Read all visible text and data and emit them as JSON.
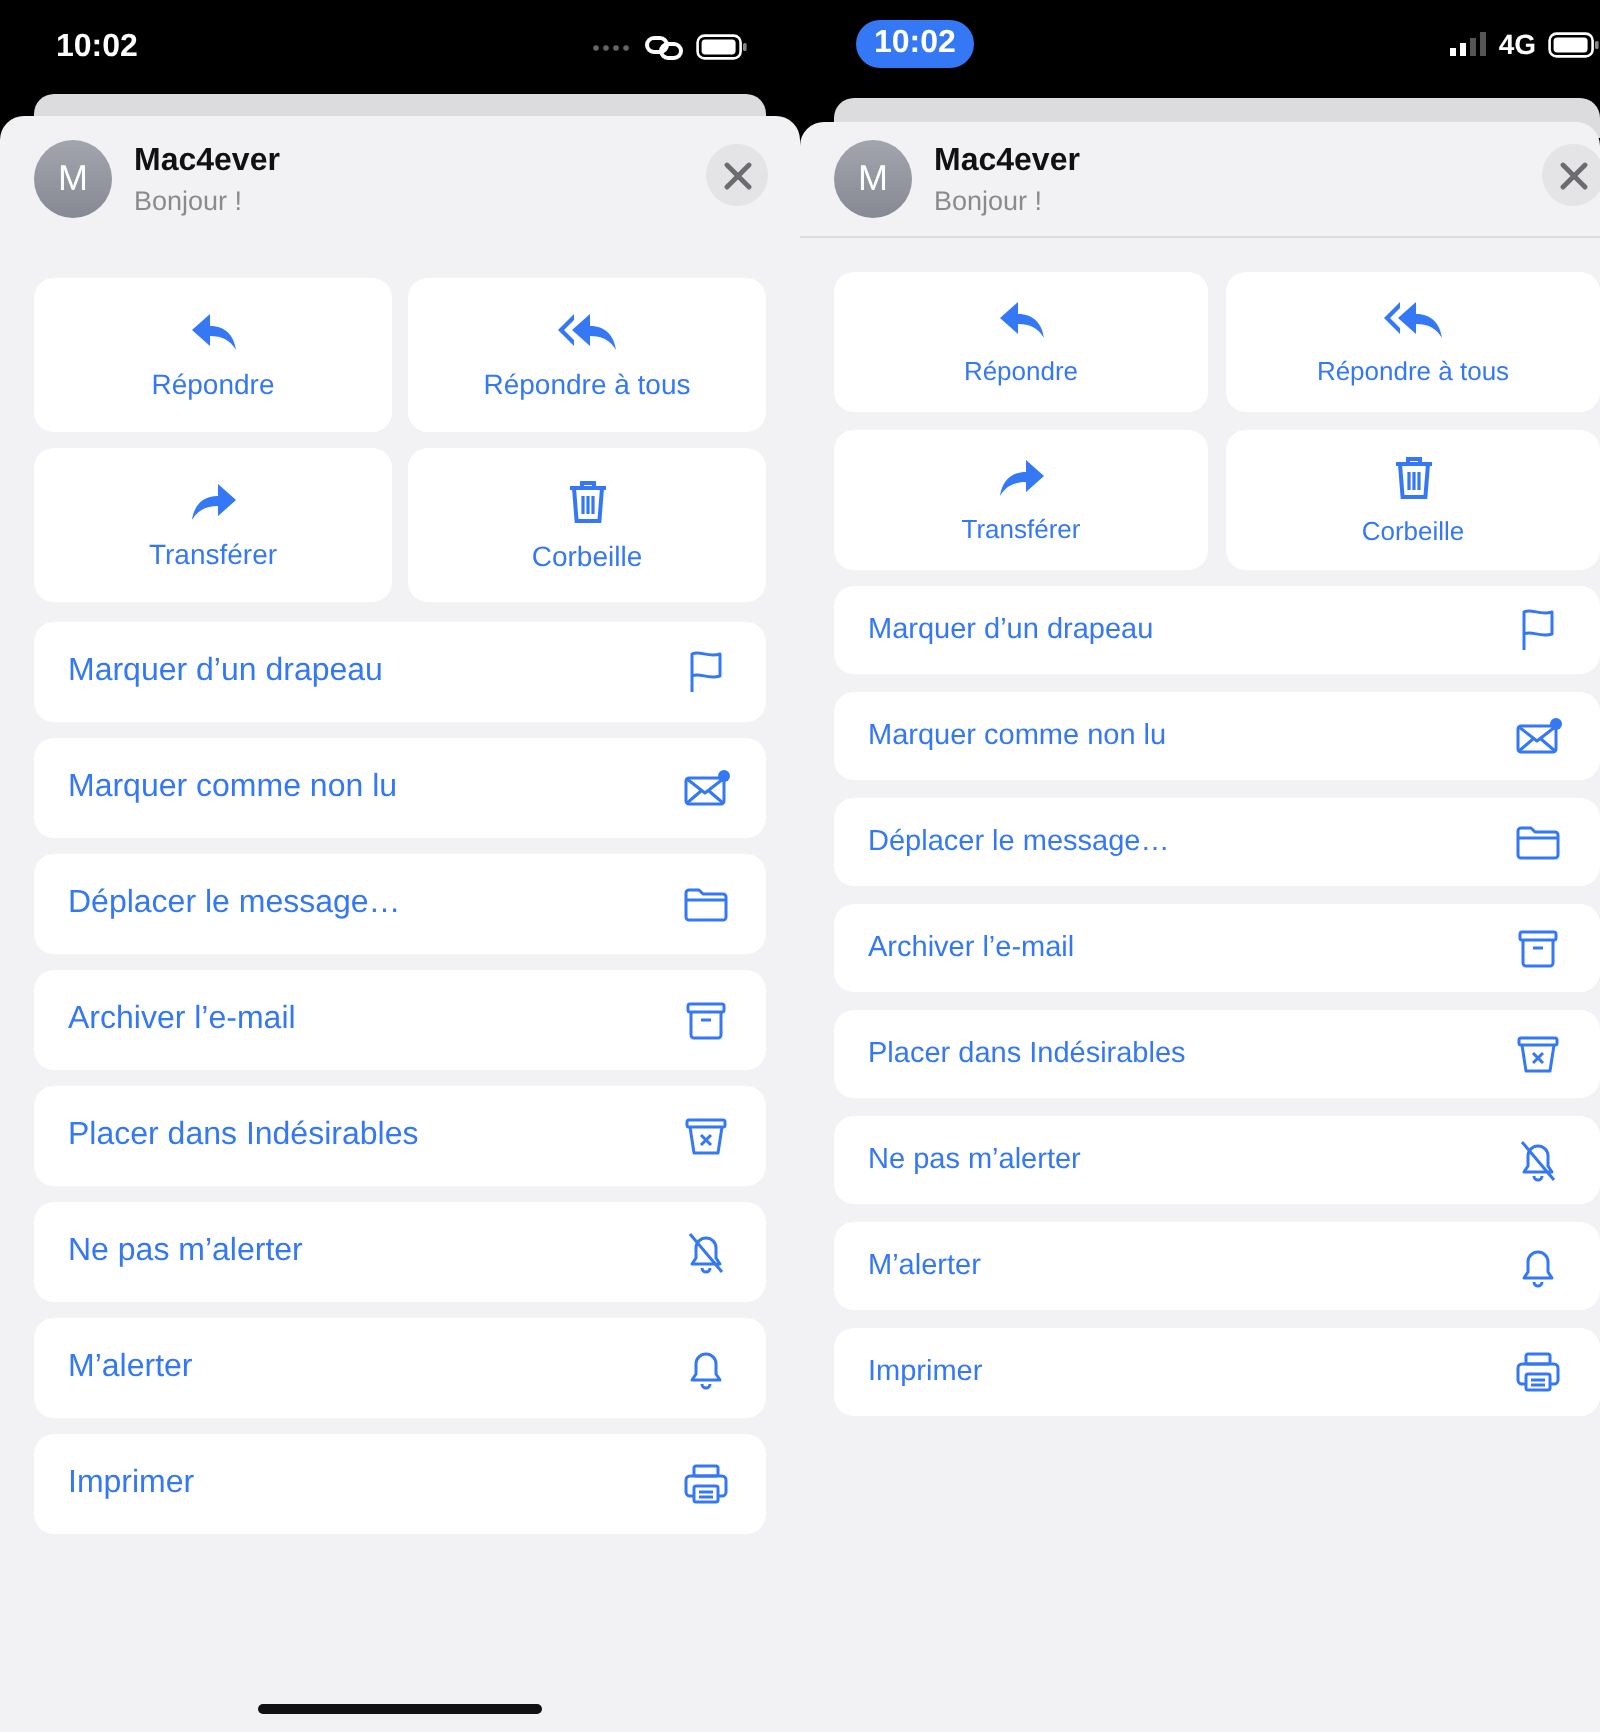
{
  "phones": [
    {
      "status_bar": {
        "time": "10:02",
        "time_highlighted": false,
        "kind": "link"
      },
      "sender": {
        "initial": "M",
        "name": "Mac4ever",
        "preview": "Bonjour !"
      },
      "header_divider": false,
      "home_indicator": true,
      "actions": [
        {
          "label": "Répondre"
        },
        {
          "label": "Répondre à tous"
        },
        {
          "label": "Transférer"
        },
        {
          "label": "Corbeille"
        }
      ],
      "menu": [
        {
          "label": "Marquer d’un drapeau"
        },
        {
          "label": "Marquer comme non lu"
        },
        {
          "label": "Déplacer le message…"
        },
        {
          "label": "Archiver l’e-mail"
        },
        {
          "label": "Placer dans Indésirables"
        },
        {
          "label": "Ne pas m’alerter"
        },
        {
          "label": "M’alerter"
        },
        {
          "label": "Imprimer"
        }
      ]
    },
    {
      "status_bar": {
        "time": "10:02",
        "time_highlighted": true,
        "kind": "cellular",
        "network": "4G"
      },
      "sender": {
        "initial": "M",
        "name": "Mac4ever",
        "preview": "Bonjour !"
      },
      "header_divider": true,
      "home_indicator": false,
      "actions": [
        {
          "label": "Répondre"
        },
        {
          "label": "Répondre à tous"
        },
        {
          "label": "Transférer"
        },
        {
          "label": "Corbeille"
        }
      ],
      "menu": [
        {
          "label": "Marquer d’un drapeau"
        },
        {
          "label": "Marquer comme non lu"
        },
        {
          "label": "Déplacer le message…"
        },
        {
          "label": "Archiver l’e-mail"
        },
        {
          "label": "Placer dans Indésirables"
        },
        {
          "label": "Ne pas m’alerter"
        },
        {
          "label": "M’alerter"
        },
        {
          "label": "Imprimer"
        }
      ]
    }
  ]
}
